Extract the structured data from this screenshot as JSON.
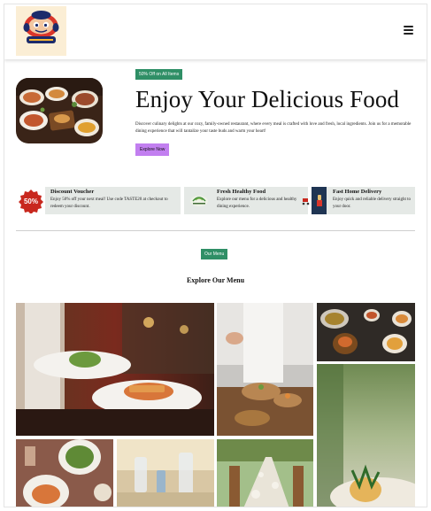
{
  "header": {
    "logo_alt": "Foster Food",
    "menu_icon": "hamburger-icon"
  },
  "hero": {
    "offer_badge": "50% Off on All Items",
    "title": "Enjoy Your Delicious Food",
    "description": "Discover culinary delights at our cozy, family-owned restaurant, where every meal is crafted with love and fresh, local ingredients. Join us for a memorable dining experience that will tantalize your taste buds and warm your heart!",
    "cta_label": "Explore Now"
  },
  "features": [
    {
      "title": "Discount Voucher",
      "description": "Enjoy 50% off your next meal! Use code TASTE20 at checkout to redeem your discount.",
      "icon": "voucher-50-icon",
      "icon_text": "50%"
    },
    {
      "title": "Fresh Healthy Food",
      "description": "Explore our menu for a delicious and healthy dining experience.",
      "icon": "fresh-food-icon"
    },
    {
      "title": "Fast Home Delivery",
      "description": "Enjoy quick and reliable delivery straight to your door.",
      "icon": "delivery-icon"
    }
  ],
  "menu": {
    "badge": "Our Menu",
    "title": "Explore Our Menu"
  },
  "colors": {
    "badge_green": "#2f8f66",
    "cta_purple": "#c27ff0",
    "feature_bg": "#e5e9e6",
    "logo_bg": "#fbeed5"
  }
}
